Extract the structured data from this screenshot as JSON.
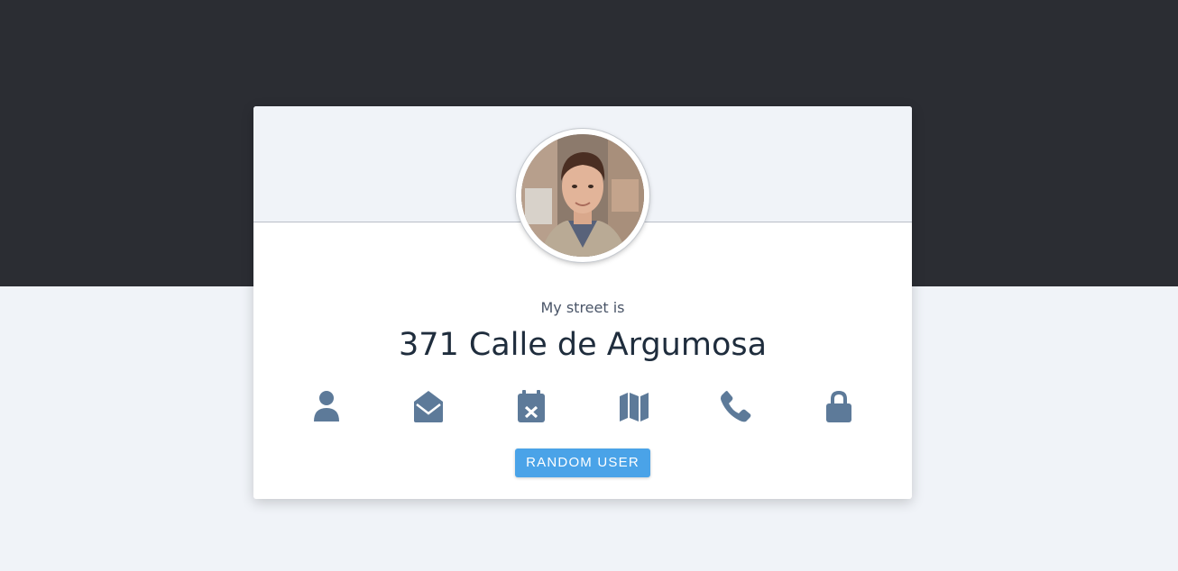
{
  "user_card": {
    "subtitle": "My street is",
    "headline": "371 Calle de Argumosa",
    "button_label": "RANDOM USER",
    "icons": [
      "user-icon",
      "envelope-open-icon",
      "calendar-x-icon",
      "map-icon",
      "phone-icon",
      "lock-icon"
    ]
  },
  "colors": {
    "top_band": "#2b2d33",
    "page_background": "#f0f3f8",
    "card_background": "#ffffff",
    "icon_color": "#5d7a99",
    "button_background": "#4aa3e8",
    "headline_text": "#1f2d3d"
  }
}
